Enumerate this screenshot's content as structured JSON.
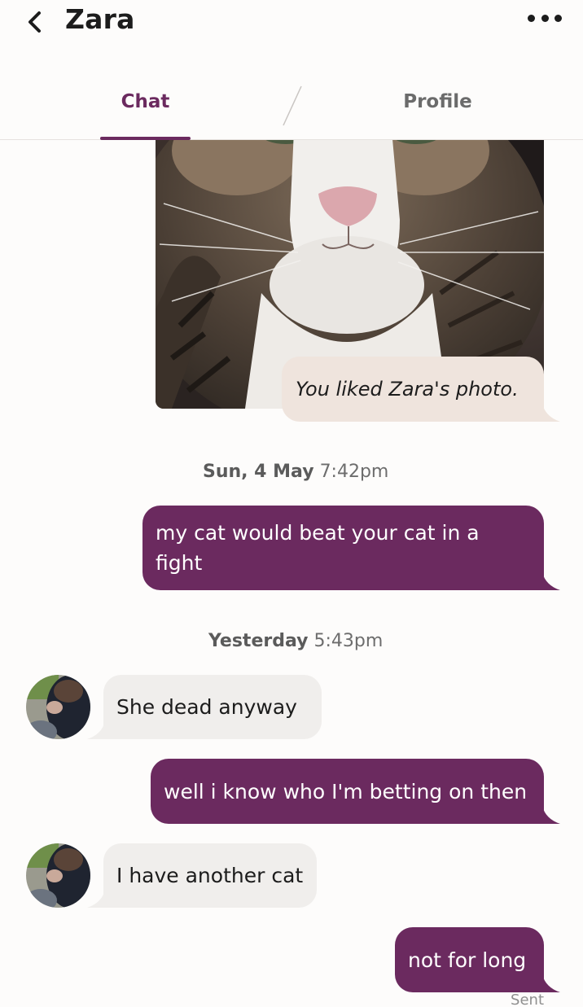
{
  "header": {
    "contact_name": "Zara",
    "back_icon": "chevron-left-icon",
    "more_icon": "more-horizontal-icon"
  },
  "tabs": [
    {
      "label": "Chat",
      "active": true
    },
    {
      "label": "Profile",
      "active": false
    }
  ],
  "colors": {
    "accent": "#6b2a5f",
    "outgoing_bubble": "#6b2a5f",
    "incoming_bubble": "#f0eeec",
    "liked_bubble": "#efe4dd"
  },
  "messages": {
    "liked_photo": {
      "text": "You liked Zara's photo."
    },
    "stamp1": {
      "day": "Sun, 4 May",
      "time": "7:42pm"
    },
    "msg1": {
      "text": "my cat would beat your cat in a fight",
      "direction": "outgoing"
    },
    "stamp2": {
      "day": "Yesterday",
      "time": "5:43pm"
    },
    "msg2": {
      "text": "She dead anyway",
      "direction": "incoming"
    },
    "msg3": {
      "text": "well i know who I'm betting on then",
      "direction": "outgoing"
    },
    "msg4": {
      "text": "I have another cat",
      "direction": "incoming"
    },
    "msg5": {
      "text": "not for long",
      "direction": "outgoing",
      "status": "Sent"
    }
  }
}
